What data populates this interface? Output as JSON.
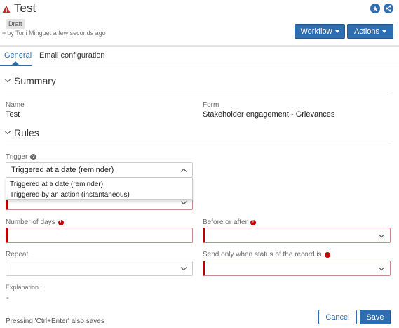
{
  "header": {
    "title": "Test",
    "status_badge": "Draft",
    "meta": "by Toni Minguet a few seconds ago",
    "workflow_label": "Workflow",
    "actions_label": "Actions",
    "icons": {
      "warning": "warning-icon",
      "star": "star-icon",
      "share": "share-icon",
      "plus": "plus-icon"
    }
  },
  "tabs": [
    {
      "label": "General",
      "active": true
    },
    {
      "label": "Email configuration",
      "active": false
    }
  ],
  "summary": {
    "heading": "Summary",
    "name_label": "Name",
    "name_value": "Test",
    "form_label": "Form",
    "form_value": "Stakeholder engagement - Grievances"
  },
  "rules": {
    "heading": "Rules",
    "trigger_label": "Trigger",
    "trigger_value": "Triggered at a date (reminder)",
    "trigger_options": [
      "Triggered at a date (reminder)",
      "Triggered by an action (instantaneous)"
    ],
    "number_of_days_label": "Number of days",
    "before_after_label": "Before or after",
    "repeat_label": "Repeat",
    "send_only_label": "Send only when status of the record is",
    "explanation_label": "Explanation :",
    "explanation_value": "-"
  },
  "footer": {
    "note": "Pressing 'Ctrl+Enter' also saves",
    "cancel_label": "Cancel",
    "save_label": "Save"
  },
  "colors": {
    "primary": "#2f6db1",
    "error": "#c00000",
    "badge_bg": "#e4e4e4"
  }
}
